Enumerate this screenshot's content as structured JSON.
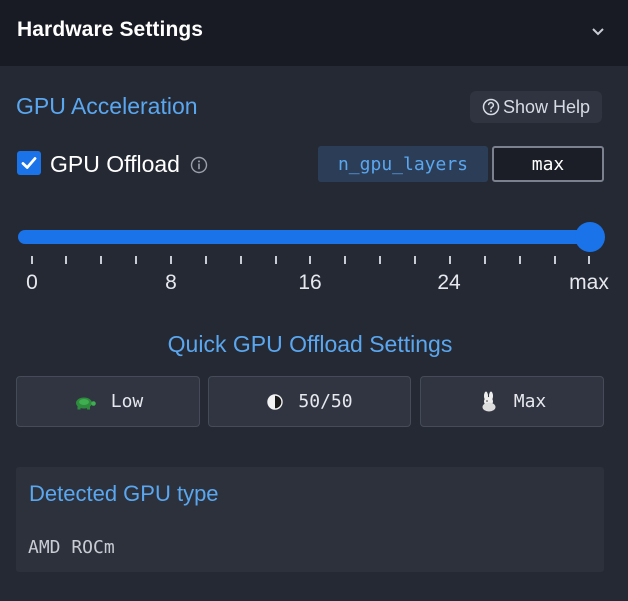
{
  "header": {
    "title": "Hardware Settings",
    "collapse_icon": "chevron-down-icon"
  },
  "gpu_acceleration": {
    "title": "GPU Acceleration",
    "help_button_label": "Show Help",
    "help_icon": "question-circle-icon"
  },
  "gpu_offload": {
    "checked": true,
    "label": "GPU Offload",
    "info_icon": "info-circle-icon",
    "param_name": "n_gpu_layers",
    "value": "max"
  },
  "slider": {
    "value_fraction": 1.0,
    "accent_color": "#1a73e8",
    "tick_labels": [
      "0",
      "8",
      "16",
      "24",
      "max"
    ]
  },
  "quick_settings": {
    "title": "Quick GPU Offload Settings",
    "buttons": [
      {
        "label": "Low",
        "icon": "turtle-icon"
      },
      {
        "label": "50/50",
        "icon": "half-circle-icon"
      },
      {
        "label": "Max",
        "icon": "rabbit-icon"
      }
    ]
  },
  "detected_gpu": {
    "title": "Detected GPU type",
    "value": "AMD ROCm"
  }
}
